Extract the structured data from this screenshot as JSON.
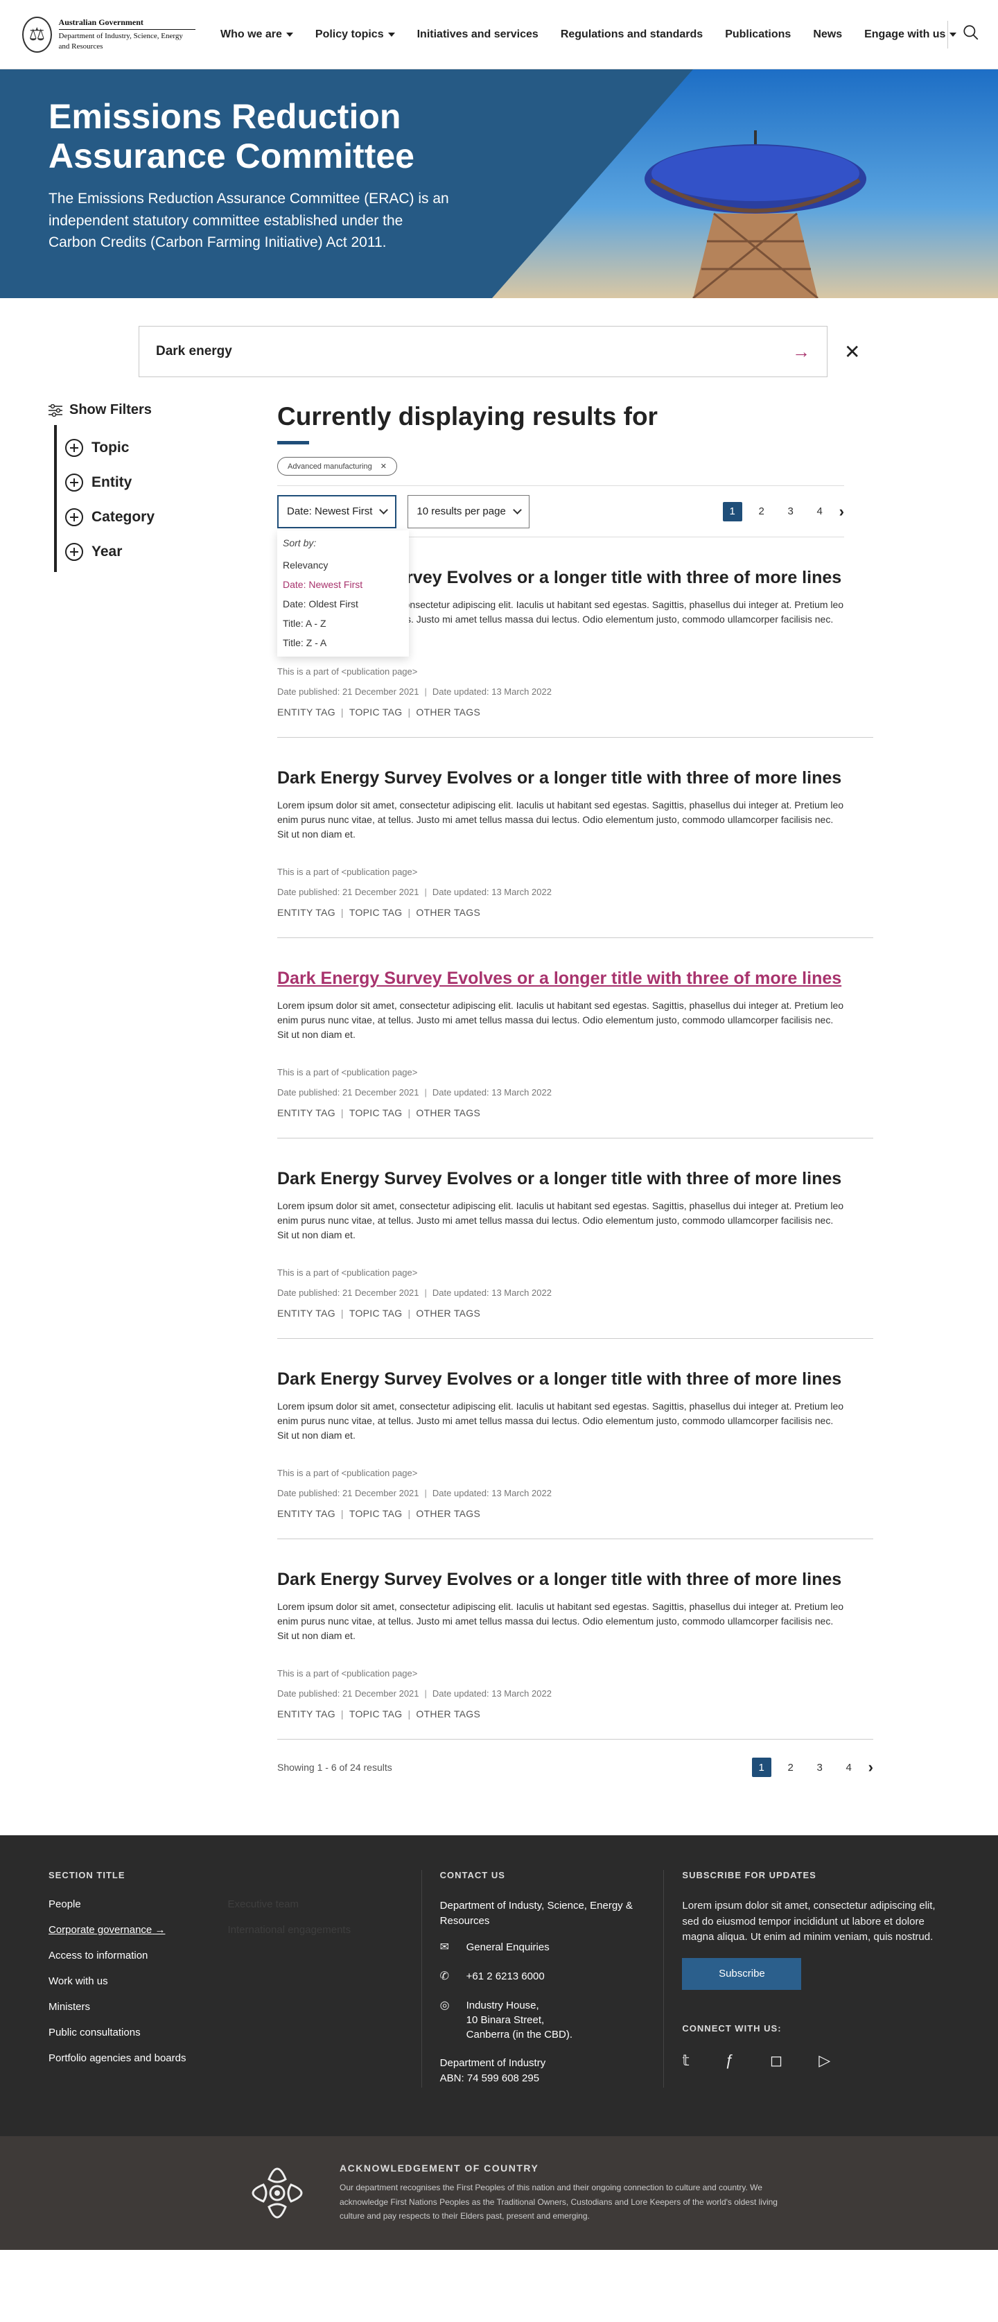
{
  "header": {
    "logo_gov": "Australian Government",
    "logo_dept": "Department of Industry, Science, Energy and Resources",
    "nav": [
      {
        "label": "Who we are",
        "caret": true
      },
      {
        "label": "Policy topics",
        "caret": true
      },
      {
        "label": "Initiatives and services",
        "caret": false
      },
      {
        "label": "Regulations and standards",
        "caret": false
      },
      {
        "label": "Publications",
        "caret": false
      },
      {
        "label": "News",
        "caret": false
      },
      {
        "label": "Engage with us",
        "caret": true
      }
    ]
  },
  "hero": {
    "title": "Emissions Reduction Assurance Committee",
    "description": "The Emissions Reduction Assurance Committee (ERAC) is an independent statutory committee established under the Carbon Credits (Carbon Farming Initiative) Act 2011."
  },
  "search": {
    "value": "Dark energy"
  },
  "filters": {
    "show_label": "Show Filters",
    "items": [
      "Topic",
      "Entity",
      "Category",
      "Year"
    ]
  },
  "results": {
    "heading": "Currently displaying results for",
    "chip": "Advanced manufacturing",
    "sort_select": "Date: Newest First",
    "per_page_select": "10 results per page",
    "pages": [
      "1",
      "2",
      "3",
      "4"
    ],
    "current_page": "1",
    "dropdown": {
      "label": "Sort by:",
      "options": [
        "Relevancy",
        "Date: Newest First",
        "Date: Oldest First",
        "Title: A - Z",
        "Title: Z - A"
      ],
      "selected": "Date: Newest First"
    },
    "items": [
      {
        "title": "Dark Energy Survey Evolves or a longer title with three of more lines",
        "body": "Lorem ipsum dolor sit amet, consectetur adipiscing elit. Iaculis ut habitant sed egestas. Sagittis, phasellus dui integer at. Pretium leo enim purus nunc vitae, at tellus. Justo mi amet tellus massa dui lectus. Odio elementum justo, commodo ullamcorper facilisis nec. Sit ut non diam et.",
        "part_of": "This is a part of <publication page>",
        "published": "Date published: 21 December 2021",
        "updated": "Date updated: 13 March 2022",
        "tags": [
          "ENTITY TAG",
          "TOPIC TAG",
          "OTHER TAGS"
        ]
      },
      {
        "title": "Dark Energy Survey Evolves or a longer title with three of more lines",
        "body": "Lorem ipsum dolor sit amet, consectetur adipiscing elit. Iaculis ut habitant sed egestas. Sagittis, phasellus dui integer at. Pretium leo enim purus nunc vitae, at tellus. Justo mi amet tellus massa dui lectus. Odio elementum justo, commodo ullamcorper facilisis nec. Sit ut non diam et.",
        "part_of": "This is a part of <publication page>",
        "published": "Date published: 21 December 2021",
        "updated": "Date updated: 13 March 2022",
        "tags": [
          "ENTITY TAG",
          "TOPIC TAG",
          "OTHER TAGS"
        ]
      },
      {
        "title": "Dark Energy Survey Evolves or a longer title with three of more lines",
        "body": "Lorem ipsum dolor sit amet, consectetur adipiscing elit. Iaculis ut habitant sed egestas. Sagittis, phasellus dui integer at. Pretium leo enim purus nunc vitae, at tellus. Justo mi amet tellus massa dui lectus. Odio elementum justo, commodo ullamcorper facilisis nec. Sit ut non diam et.",
        "part_of": "This is a part of <publication page>",
        "published": "Date published: 21 December 2021",
        "updated": "Date updated: 13 March 2022",
        "tags": [
          "ENTITY TAG",
          "TOPIC TAG",
          "OTHER TAGS"
        ]
      },
      {
        "title": "Dark Energy Survey Evolves or a longer title with three of more lines",
        "body": "Lorem ipsum dolor sit amet, consectetur adipiscing elit. Iaculis ut habitant sed egestas. Sagittis, phasellus dui integer at. Pretium leo enim purus nunc vitae, at tellus. Justo mi amet tellus massa dui lectus. Odio elementum justo, commodo ullamcorper facilisis nec. Sit ut non diam et.",
        "part_of": "This is a part of <publication page>",
        "published": "Date published: 21 December 2021",
        "updated": "Date updated: 13 March 2022",
        "tags": [
          "ENTITY TAG",
          "TOPIC TAG",
          "OTHER TAGS"
        ]
      },
      {
        "title": "Dark Energy Survey Evolves or a longer title with three of more lines",
        "body": "Lorem ipsum dolor sit amet, consectetur adipiscing elit. Iaculis ut habitant sed egestas. Sagittis, phasellus dui integer at. Pretium leo enim purus nunc vitae, at tellus. Justo mi amet tellus massa dui lectus. Odio elementum justo, commodo ullamcorper facilisis nec. Sit ut non diam et.",
        "part_of": "This is a part of <publication page>",
        "published": "Date published: 21 December 2021",
        "updated": "Date updated: 13 March 2022",
        "tags": [
          "ENTITY TAG",
          "TOPIC TAG",
          "OTHER TAGS"
        ]
      },
      {
        "title": "Dark Energy Survey Evolves or a longer title with three of more lines",
        "body": "Lorem ipsum dolor sit amet, consectetur adipiscing elit. Iaculis ut habitant sed egestas. Sagittis, phasellus dui integer at. Pretium leo enim purus nunc vitae, at tellus. Justo mi amet tellus massa dui lectus. Odio elementum justo, commodo ullamcorper facilisis nec. Sit ut non diam et.",
        "part_of": "This is a part of <publication page>",
        "published": "Date published: 21 December 2021",
        "updated": "Date updated: 13 March 2022",
        "tags": [
          "ENTITY TAG",
          "TOPIC TAG",
          "OTHER TAGS"
        ]
      }
    ],
    "showing": "Showing 1 - 6 of 24 results"
  },
  "footer": {
    "section_title": "SECTION TITLE",
    "links_col1": [
      "People",
      "Corporate governance",
      "Access to information",
      "Work with us",
      "Ministers",
      "Public consultations",
      "Portfolio agencies and boards"
    ],
    "links_col2": [
      "Executive team",
      "International engagements"
    ],
    "contact_title": "CONTACT US",
    "contact_org": "Department of Industy, Science, Energy & Resources",
    "enquiries": "General Enquiries",
    "phone": "+61 2 6213 6000",
    "address": [
      "Industry House,",
      "10 Binara Street,",
      "Canberra (in the CBD)."
    ],
    "abn_org": "Department of Industry",
    "abn": "ABN: 74 599 608 295",
    "subscribe_title": "SUBSCRIBE FOR UPDATES",
    "subscribe_text": "Lorem ipsum dolor sit amet, consectetur adipiscing elit, sed do eiusmod tempor incididunt ut labore et dolore magna aliqua. Ut enim ad minim veniam, quis nostrud.",
    "subscribe_button": "Subscribe",
    "connect_title": "CONNECT WITH US:",
    "social": [
      "twitter-icon",
      "facebook-icon",
      "instagram-icon",
      "youtube-icon"
    ]
  },
  "acknowledgement": {
    "title": "ACKNOWLEDGEMENT OF COUNTRY",
    "text": "Our department recognises the First Peoples of this nation and their ongoing connection to culture and country. We acknowledge First Nations Peoples as the Traditional Owners, Custodians and Lore Keepers of the world's oldest living culture and pay respects to their Elders past, present and emerging."
  },
  "colors": {
    "primary": "#1f4e79",
    "accent": "#a8336d",
    "footer": "#2b2b2b"
  }
}
